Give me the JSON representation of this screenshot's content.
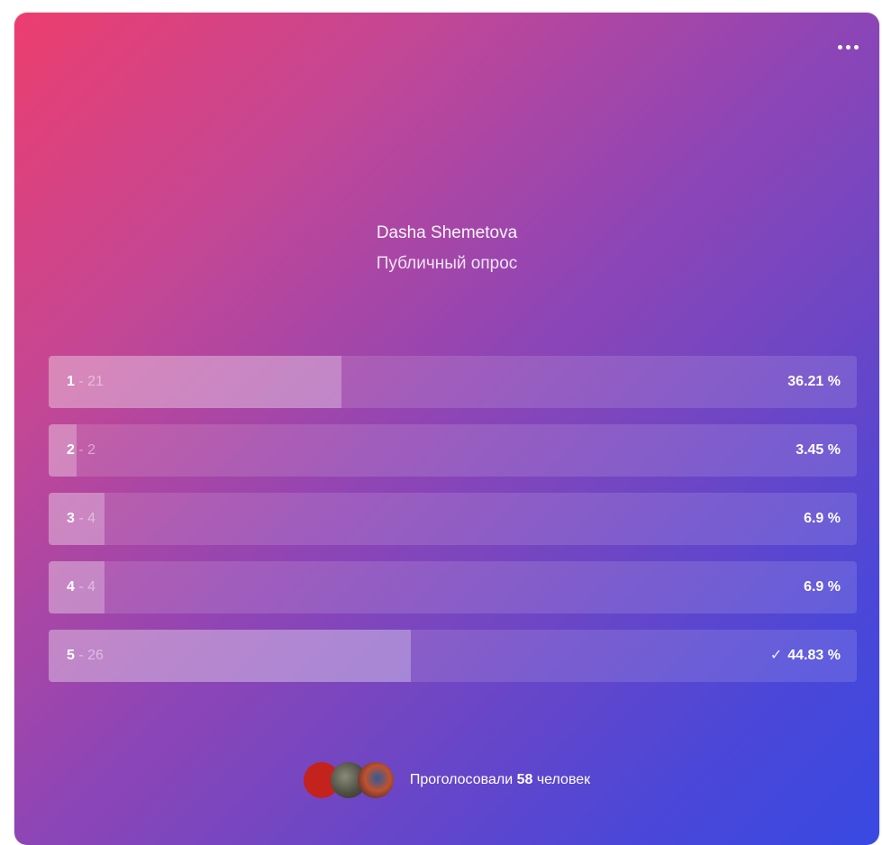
{
  "poll": {
    "author": "Dasha Shemetova",
    "subtitle": "Публичный опрос",
    "options": [
      {
        "name": "1",
        "sep": " - ",
        "count": "21",
        "percent_label": "36.21 %",
        "fraction": 0.3621,
        "checked": false
      },
      {
        "name": "2",
        "sep": " - ",
        "count": "2",
        "percent_label": "3.45 %",
        "fraction": 0.0345,
        "checked": false
      },
      {
        "name": "3",
        "sep": " - ",
        "count": "4",
        "percent_label": "6.9 %",
        "fraction": 0.069,
        "checked": false
      },
      {
        "name": "4",
        "sep": " - ",
        "count": "4",
        "percent_label": "6.9 %",
        "fraction": 0.069,
        "checked": false
      },
      {
        "name": "5",
        "sep": " - ",
        "count": "26",
        "percent_label": "44.83 %",
        "fraction": 0.4483,
        "checked": true
      }
    ]
  },
  "footer": {
    "voted_prefix": "Проголосовали",
    "voted_count": "58",
    "voted_suffix": "человек"
  },
  "icons": {
    "menu": "more-dots-icon",
    "check": "checkmark-icon"
  },
  "colors": {
    "gradient_start": "#ec3e6e",
    "gradient_mid": "#9145b4",
    "gradient_end": "#3849e2"
  }
}
